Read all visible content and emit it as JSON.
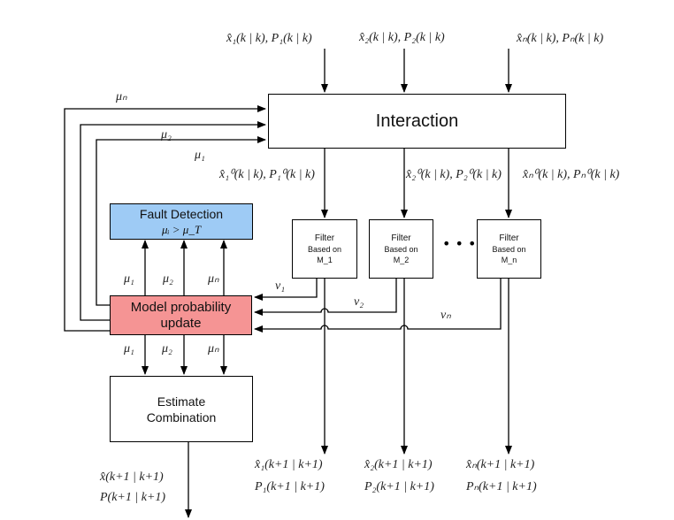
{
  "diagram": {
    "interaction": {
      "label": "Interaction"
    },
    "fault_detection": {
      "label": "Fault Detection",
      "condition": "μᵢ > μ_T",
      "color": "#9ecbf5"
    },
    "model_update": {
      "label_line1": "Model probability",
      "label_line2": "update",
      "color": "#f59494"
    },
    "estimate": {
      "label_line1": "Estimate",
      "label_line2": "Combination"
    },
    "filters": [
      {
        "title": "Filter",
        "line2": "Based on",
        "line3": "M_1"
      },
      {
        "title": "Filter",
        "line2": "Based on",
        "line3": "M_2"
      },
      {
        "title": "Filter",
        "line2": "Based on",
        "line3": "M_n"
      }
    ],
    "ellipsis": "• • •",
    "inputs": [
      "x̂₁(k | k), P₁(k | k)",
      "x̂₂(k | k), P₂(k | k)",
      "x̂ₙ(k | k), Pₙ(k | k)"
    ],
    "mixed": [
      "x̂₁⁰(k | k), P₁⁰(k | k)",
      "x̂₂⁰(k | k), P₂⁰(k | k)",
      "x̂ₙ⁰(k | k), Pₙ⁰(k | k)"
    ],
    "feedback_labels": [
      "μₙ",
      "μ₂",
      "μ₁"
    ],
    "up_labels": [
      "μ₁",
      "μ₂",
      "μₙ"
    ],
    "down_labels": [
      "μ₁",
      "μ₂",
      "μₙ"
    ],
    "likelihoods": [
      "v₁",
      "v₂",
      "vₙ"
    ],
    "outputs": [
      {
        "x": "x̂₁(k+1 | k+1)",
        "p": "P₁(k+1 | k+1)"
      },
      {
        "x": "x̂₂(k+1 | k+1)",
        "p": "P₂(k+1 | k+1)"
      },
      {
        "x": "x̂ₙ(k+1 | k+1)",
        "p": "Pₙ(k+1 | k+1)"
      }
    ],
    "combined_output": {
      "x": "x̂(k+1 | k+1)",
      "p": "P(k+1 | k+1)"
    }
  }
}
